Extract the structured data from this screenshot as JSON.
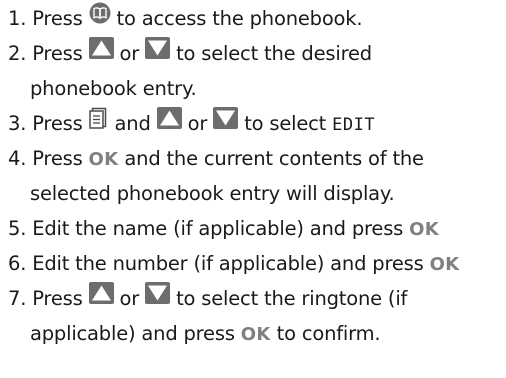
{
  "steps": [
    {
      "num": "1.",
      "parts": [
        "Press",
        "to access the phonebook."
      ],
      "icon": "phonebook-icon"
    },
    {
      "num": "2.",
      "parts": [
        "Press",
        "or",
        "to select the desired"
      ],
      "cont": "phonebook entry.",
      "icons": [
        "up-arrow-icon",
        "down-arrow-icon"
      ]
    },
    {
      "num": "3.",
      "parts": [
        "Press",
        "and",
        "or",
        "to select"
      ],
      "lcd_text": "EDIT",
      "icons": [
        "menu-icon",
        "up-arrow-icon",
        "down-arrow-icon"
      ]
    },
    {
      "num": "4.",
      "parts": [
        "Press",
        "and the current contents of the"
      ],
      "ok": "OK",
      "cont": "selected phonebook entry will display."
    },
    {
      "num": "5.",
      "parts": [
        "Edit the name (if applicable) and press"
      ],
      "ok": "OK"
    },
    {
      "num": "6.",
      "parts": [
        "Edit the number (if applicable) and press"
      ],
      "ok": "OK"
    },
    {
      "num": "7.",
      "parts": [
        "Press",
        "or",
        "to select the ringtone (if"
      ],
      "cont_parts": [
        "applicable) and press",
        "to confirm."
      ],
      "ok": "OK",
      "icons": [
        "up-arrow-icon",
        "down-arrow-icon"
      ]
    }
  ],
  "colors": {
    "text": "#1a1a1a",
    "icon_fill": "#6d6d6d",
    "ok_text": "#808080"
  }
}
